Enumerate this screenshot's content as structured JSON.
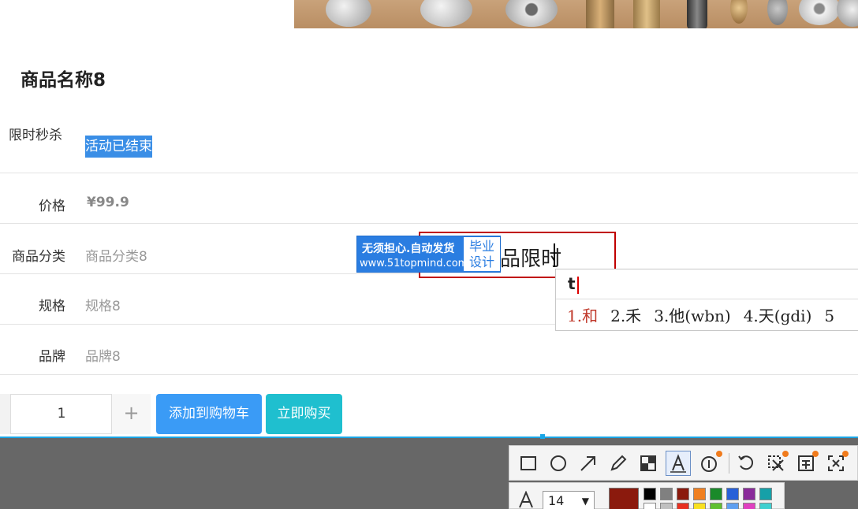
{
  "product": {
    "title": "商品名称8",
    "flash_label": "限时秒杀",
    "flash_status": "活动已结束",
    "price_label": "价格",
    "price_value": "¥99.9",
    "category_label": "商品分类",
    "category_value": "商品分类8",
    "spec_label": "规格",
    "spec_value": "规格8",
    "brand_label": "品牌",
    "brand_value": "品牌8"
  },
  "purchase": {
    "quantity": "1",
    "plus_symbol": "+",
    "add_to_cart": "添加到购物车",
    "buy_now": "立即购买"
  },
  "watermark": {
    "line1": "无须担心.自动发货",
    "line2": "www.51topmind.com",
    "right_top": "毕业",
    "right_bottom": "设计"
  },
  "annotation": {
    "text": "品限时"
  },
  "ime": {
    "input": "t",
    "candidates": [
      "1.和",
      "2.禾",
      "3.他(wbn)",
      "4.天(gdi)",
      "5"
    ]
  },
  "screenshot_toolbar": {
    "tools": [
      "rectangle-icon",
      "circle-icon",
      "arrow-icon",
      "pencil-icon",
      "mosaic-icon",
      "text-icon",
      "number-icon",
      "undo-icon",
      "cut-icon",
      "ocr-icon",
      "close-icon"
    ],
    "active_tool": "text-icon",
    "font_size": "14",
    "current_color": "#8b1a0d",
    "palette": [
      "#000000",
      "#808080",
      "#8b1a0d",
      "#f08020",
      "#1a8a2a",
      "#2860d8",
      "#8a2a9a",
      "#16a0a8",
      "#ffffff",
      "#c0c0c0",
      "#e83020",
      "#f8e020",
      "#60c030",
      "#60a0f0",
      "#e040c0",
      "#40d0d0"
    ]
  }
}
